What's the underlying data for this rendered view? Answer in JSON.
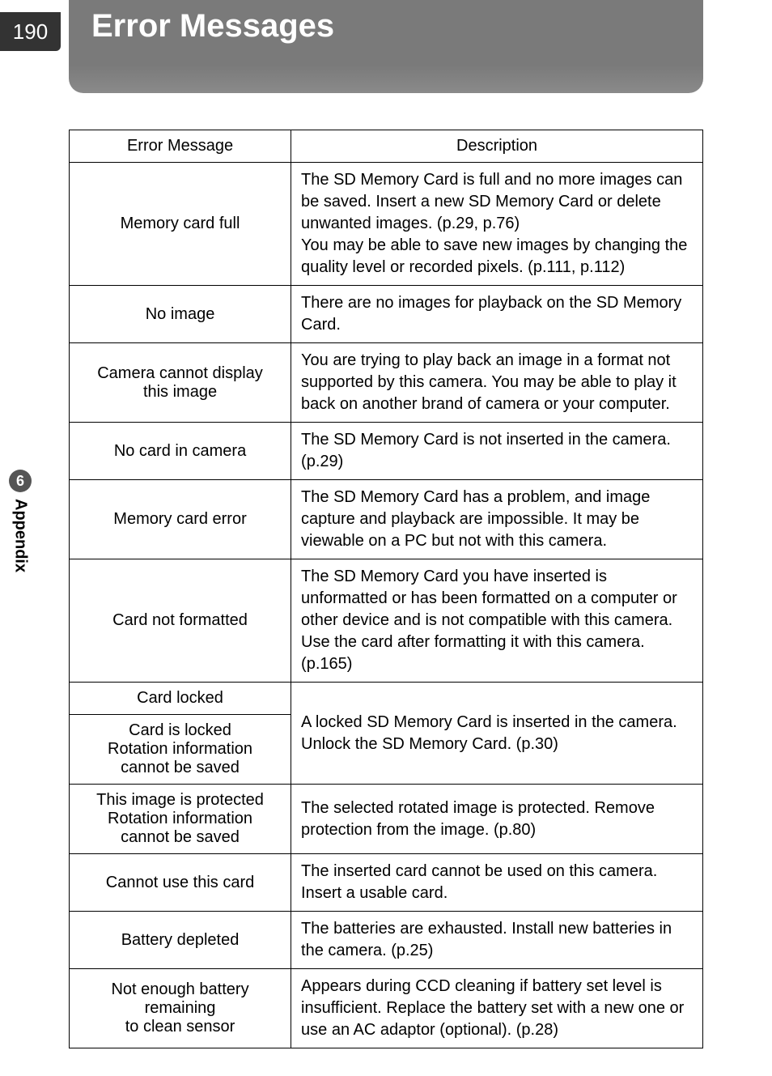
{
  "page_number": "190",
  "title": "Error Messages",
  "sidebar": {
    "number": "6",
    "label": "Appendix"
  },
  "table": {
    "header_msg": "Error Message",
    "header_desc": "Description",
    "rows": [
      {
        "msg": "Memory card full",
        "desc": "The SD Memory Card is full and no more images can be saved. Insert a new SD Memory Card or delete unwanted images. (p.29, p.76)\nYou may be able to save new images by changing the quality level or recorded pixels. (p.111, p.112)"
      },
      {
        "msg": "No image",
        "desc": "There are no images for playback on the SD Memory Card."
      },
      {
        "msg": "Camera cannot display\nthis image",
        "desc": "You are trying to play back an image in a format not supported by this camera. You may be able to play it back on another brand of camera or your computer."
      },
      {
        "msg": "No card in camera",
        "desc": "The SD Memory Card is not inserted in the camera. (p.29)"
      },
      {
        "msg": "Memory card error",
        "desc": "The SD Memory Card has a problem, and image capture and playback are impossible. It may be viewable on a PC but not with this camera."
      },
      {
        "msg": "Card not formatted",
        "desc": "The SD Memory Card you have inserted is unformatted or has been formatted on a computer or other device and is not compatible with this camera. Use the card after formatting it with this camera. (p.165)"
      },
      {
        "msg": "Card locked",
        "desc_merged_with_next": true
      },
      {
        "msg": "Card is locked\nRotation information\ncannot be saved",
        "desc": "A locked SD Memory Card is inserted in the camera. Unlock the SD Memory Card. (p.30)"
      },
      {
        "msg": "This image is protected\nRotation information\ncannot be saved",
        "desc": "The selected rotated image is protected. Remove protection from the image. (p.80)"
      },
      {
        "msg": "Cannot use this card",
        "desc": "The inserted card cannot be used on this camera. Insert a usable card."
      },
      {
        "msg": "Battery depleted",
        "desc": "The batteries are exhausted. Install new batteries in the camera. (p.25)"
      },
      {
        "msg": "Not enough battery\nremaining\nto clean sensor",
        "desc": "Appears during CCD cleaning if battery set level is insufficient. Replace the battery set with a new one or use an AC adaptor (optional). (p.28)"
      }
    ]
  }
}
